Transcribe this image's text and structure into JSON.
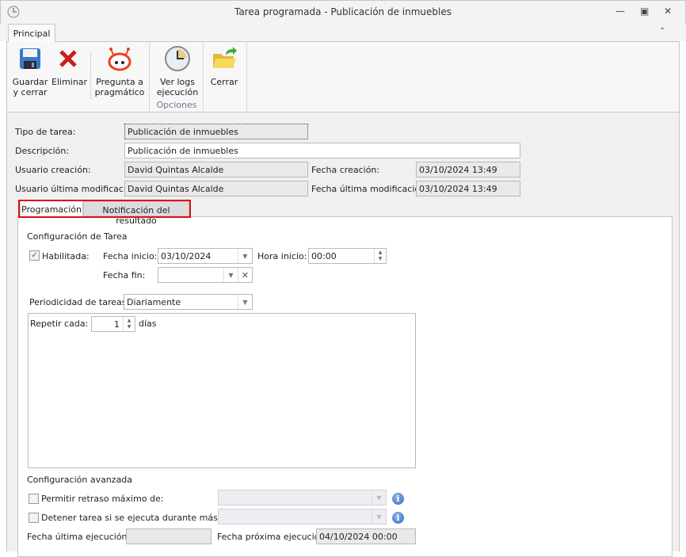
{
  "window": {
    "title": "Tarea programada - Publicación de inmuebles"
  },
  "ribbon": {
    "tab": "Principal",
    "buttons": [
      {
        "label1": "Guardar",
        "label2": "y cerrar"
      },
      {
        "label1": "Eliminar",
        "label2": ""
      },
      {
        "label1": "Pregunta a",
        "label2": "pragmático"
      },
      {
        "label1": "Ver logs",
        "label2": "ejecución"
      },
      {
        "label1": "Cerrar",
        "label2": ""
      }
    ],
    "group_label": "Opciones"
  },
  "form": {
    "tipo_label": "Tipo de tarea:",
    "tipo_value": "Publicación de inmuebles",
    "desc_label": "Descripción:",
    "desc_value": "Publicación de inmuebles",
    "ucre_label": "Usuario creación:",
    "ucre_value": "David Quintas Alcalde",
    "fcre_label": "Fecha creación:",
    "fcre_value": "03/10/2024 13:49",
    "umod_label": "Usuario última modificación:",
    "umod_value": "David Quintas Alcalde",
    "fmod_label": "Fecha última modificación:",
    "fmod_value": "03/10/2024 13:49"
  },
  "tabs": [
    "Programación",
    "Notificación del resultado"
  ],
  "prog": {
    "section1": "Configuración de Tarea",
    "habilitada": "Habilitada:",
    "habilitada_checked": true,
    "fini_label": "Fecha inicio:",
    "fini_value": "03/10/2024",
    "hini_label": "Hora inicio:",
    "hini_value": "00:00",
    "ffin_label": "Fecha fin:",
    "ffin_value": "",
    "period_label": "Periodicidad de tareas:",
    "period_value": "Diariamente",
    "repetir_label": "Repetir cada:",
    "repetir_value": "1",
    "repetir_unit": "días",
    "section2": "Configuración avanzada",
    "retraso_label": "Permitir retraso máximo de:",
    "detener_label": "Detener tarea si se ejecuta durante más de:",
    "fult_label": "Fecha última ejecución:",
    "fult_value": "",
    "fprox_label": "Fecha próxima ejecución:",
    "fprox_value": "04/10/2024 00:00"
  }
}
